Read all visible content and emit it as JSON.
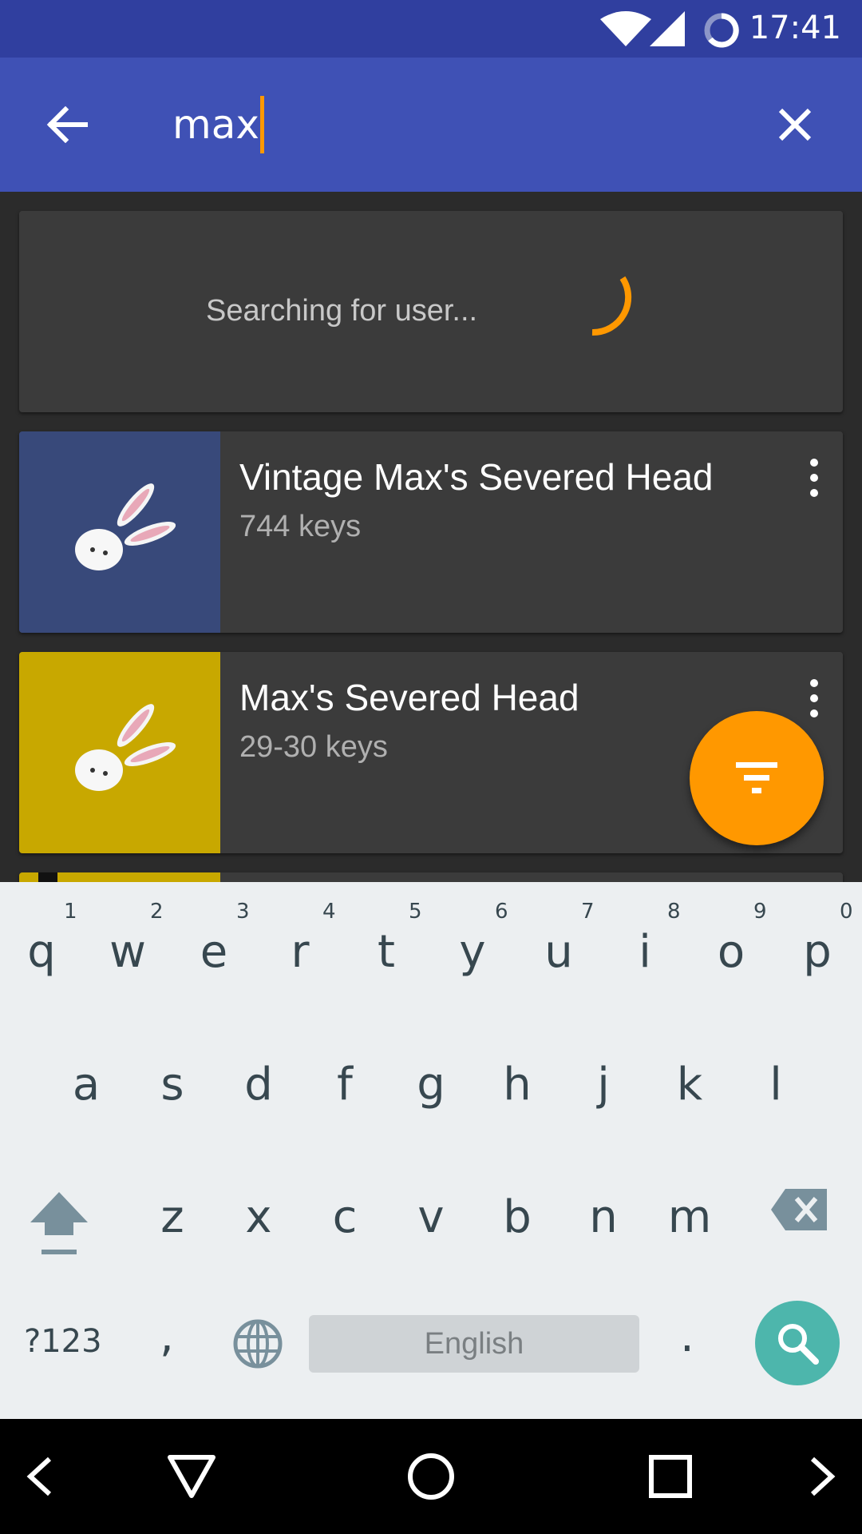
{
  "status_bar": {
    "time": "17:41"
  },
  "app_bar": {
    "query": "max",
    "back_icon": "arrow-left-icon",
    "clear_icon": "close-icon"
  },
  "searching": {
    "text": "Searching for user..."
  },
  "items": [
    {
      "title": "Vintage Max's Severed Head",
      "subtitle": "744 keys",
      "bg": "#38497a"
    },
    {
      "title": "Max's Severed Head",
      "subtitle": "29-30 keys",
      "bg": "#c8a800"
    }
  ],
  "fab": {
    "icon": "filter-icon",
    "color": "#ff9800"
  },
  "keyboard": {
    "row1": [
      "q",
      "w",
      "e",
      "r",
      "t",
      "y",
      "u",
      "i",
      "o",
      "p"
    ],
    "row1_nums": [
      "1",
      "2",
      "3",
      "4",
      "5",
      "6",
      "7",
      "8",
      "9",
      "0"
    ],
    "row2": [
      "a",
      "s",
      "d",
      "f",
      "g",
      "h",
      "j",
      "k",
      "l"
    ],
    "row3": [
      "z",
      "x",
      "c",
      "v",
      "b",
      "n",
      "m"
    ],
    "symbols_label": "?123",
    "comma": ",",
    "space_label": "English",
    "period": ".",
    "search_key_color": "#4db6ac"
  },
  "colors": {
    "primary": "#3f51b5",
    "primary_dark": "#303f9f",
    "accent": "#ff9800"
  }
}
